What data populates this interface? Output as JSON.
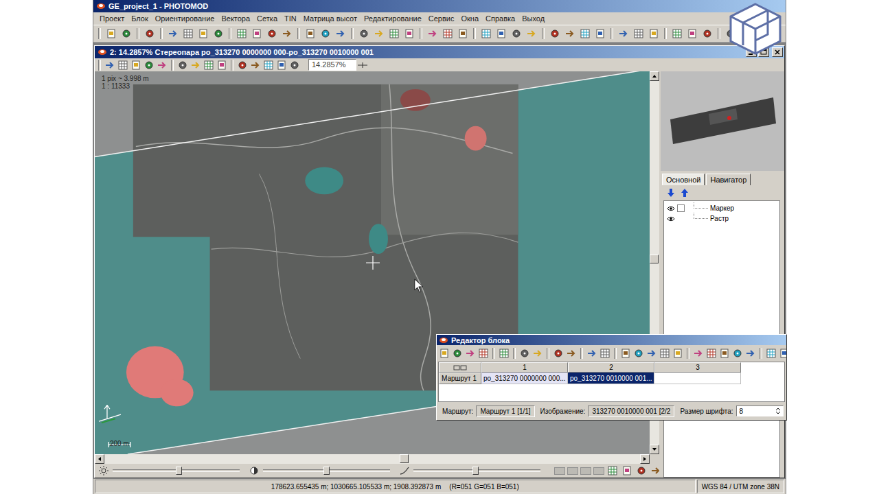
{
  "app": {
    "title": "GE_project_1 - PHOTOMOD"
  },
  "menu": [
    "Проект",
    "Блок",
    "Ориентирование",
    "Вектора",
    "Сетка",
    "TIN",
    "Матрица высот",
    "Редактирование",
    "Сервис",
    "Окна",
    "Справка",
    "Выход"
  ],
  "stereo_window": {
    "title": "2: 14.2857% Стереопара po_313270 0000000 000-po_313270 0010000 001",
    "zoom": "14.2857%"
  },
  "viewer": {
    "info": [
      "1 pix ~ 3.998 m",
      "1 : 11333"
    ],
    "scale_label": "200 m"
  },
  "scrollbars": {
    "horizontal": 0.56,
    "vertical": 0.49
  },
  "side_panel": {
    "tabs": [
      {
        "label": "Основной",
        "selected": true
      },
      {
        "label": "Навигатор",
        "selected": false
      }
    ],
    "layers": [
      {
        "name": "Маркер",
        "kind": "checkbox",
        "visible": true,
        "checked": false
      },
      {
        "name": "Растр",
        "kind": "plain",
        "visible": true
      }
    ]
  },
  "adjust_sliders": [
    {
      "kind": "brightness",
      "level": 0.52
    },
    {
      "kind": "contrast",
      "level": 0.5
    },
    {
      "kind": "gamma",
      "level": 0.49
    }
  ],
  "status_bar": {
    "coordinates": "178623.655435 m; 1030665.105533 m; 1908.392873 m",
    "pixel": "(R=051 G=051 B=051)",
    "crs": "WGS 84 / UTM zone 38N"
  },
  "block_editor": {
    "title": "Редактор блока",
    "columns": [
      "1",
      "2",
      "3"
    ],
    "rows": [
      {
        "label": "Маршрут 1",
        "cells": [
          {
            "text": "po_313270 0000000 000...",
            "selected": false
          },
          {
            "text": "po_313270 0010000 001...",
            "selected": true
          }
        ]
      }
    ],
    "footer": [
      {
        "label": "Маршрут:",
        "value": "Маршрут 1 [1/1]",
        "kind": "readonly"
      },
      {
        "label": "Изображение:",
        "value": "313270 0010000 001 [2/2",
        "kind": "readonly"
      },
      {
        "label": "Размер шрифта:",
        "value": "8",
        "kind": "input"
      }
    ]
  }
}
